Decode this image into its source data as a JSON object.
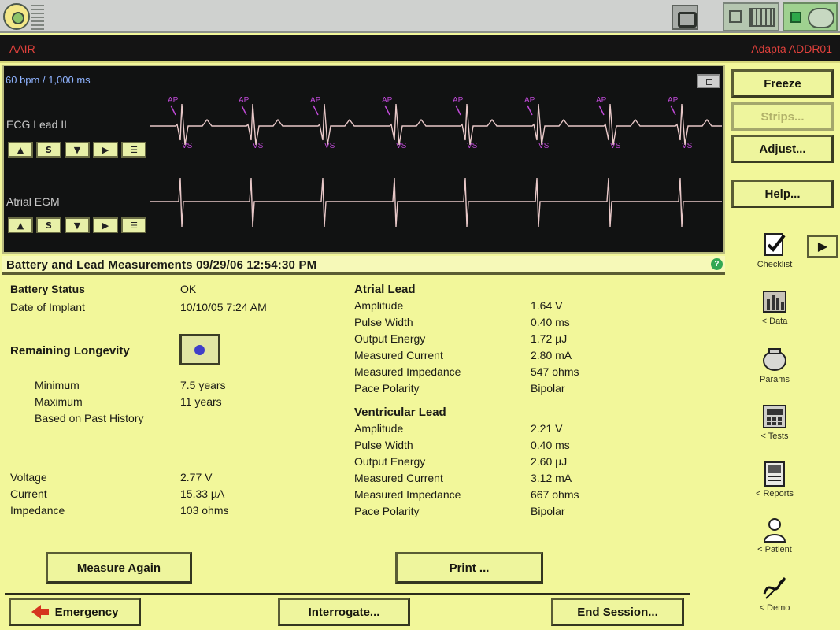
{
  "mode_bar": {
    "pacing_mode": "AAIR",
    "device_model": "Adapta ADDR01"
  },
  "ecg": {
    "rate_label": "60 bpm / 1,000 ms",
    "channel1_label": "ECG Lead II",
    "channel2_label": "Atrial EGM",
    "marker_labels": {
      "atrial_pace": "AP",
      "ventricular_sense": "VS"
    },
    "controls": [
      "▲",
      "S",
      "▼",
      "▶",
      "☰"
    ]
  },
  "side_buttons": [
    {
      "label": "Freeze",
      "enabled": true
    },
    {
      "label": "Strips...",
      "enabled": false
    },
    {
      "label": "Adjust...",
      "enabled": true
    },
    {
      "label": "Help...",
      "enabled": true
    }
  ],
  "side_nav": [
    {
      "label": "Checklist",
      "icon": "checklist-icon"
    },
    {
      "label": "< Data",
      "icon": "data-icon"
    },
    {
      "label": "Params",
      "icon": "params-icon"
    },
    {
      "label": "< Tests",
      "icon": "tests-icon"
    },
    {
      "label": "< Reports",
      "icon": "reports-icon"
    },
    {
      "label": "< Patient",
      "icon": "patient-icon"
    },
    {
      "label": "< Demo",
      "icon": "demo-icon"
    }
  ],
  "measurements": {
    "header": "Battery and Lead Measurements 09/29/06 12:54:30 PM",
    "battery_status_label": "Battery Status",
    "battery_status_value": "OK",
    "implant_label": "Date of Implant",
    "implant_value": "10/10/05 7:24 AM",
    "longevity_label": "Remaining Longevity",
    "minimum_label": "Minimum",
    "minimum_value": "7.5 years",
    "maximum_label": "Maximum",
    "maximum_value": "11 years",
    "history_label": "Based on Past History",
    "voltage_label": "Voltage",
    "voltage_value": "2.77 V",
    "current_label": "Current",
    "current_value": "15.33 µA",
    "impedance_label": "Impedance",
    "impedance_value": "103 ohms",
    "atrial": {
      "title": "Atrial Lead",
      "rows": [
        {
          "label": "Amplitude",
          "value": "1.64 V"
        },
        {
          "label": "Pulse Width",
          "value": "0.40 ms"
        },
        {
          "label": "Output Energy",
          "value": "1.72 µJ"
        },
        {
          "label": "Measured Current",
          "value": "2.80 mA"
        },
        {
          "label": "Measured Impedance",
          "value": "547 ohms"
        },
        {
          "label": "Pace Polarity",
          "value": "Bipolar"
        }
      ]
    },
    "ventricular": {
      "title": "Ventricular Lead",
      "rows": [
        {
          "label": "Amplitude",
          "value": "2.21 V"
        },
        {
          "label": "Pulse Width",
          "value": "0.40 ms"
        },
        {
          "label": "Output Energy",
          "value": "2.60 µJ"
        },
        {
          "label": "Measured Current",
          "value": "3.12 mA"
        },
        {
          "label": "Measured Impedance",
          "value": "667 ohms"
        },
        {
          "label": "Pace Polarity",
          "value": "Bipolar"
        }
      ]
    }
  },
  "actions": {
    "measure_again": "Measure Again",
    "print": "Print ...",
    "emergency": "Emergency",
    "interrogate": "Interrogate...",
    "end_session": "End Session..."
  },
  "colors": {
    "panel_bg": "#f2f79a",
    "ecg_bg": "#111212",
    "marker": "#c04ad8",
    "trace": "#e8c8c8",
    "mode_text": "#e0413c"
  }
}
